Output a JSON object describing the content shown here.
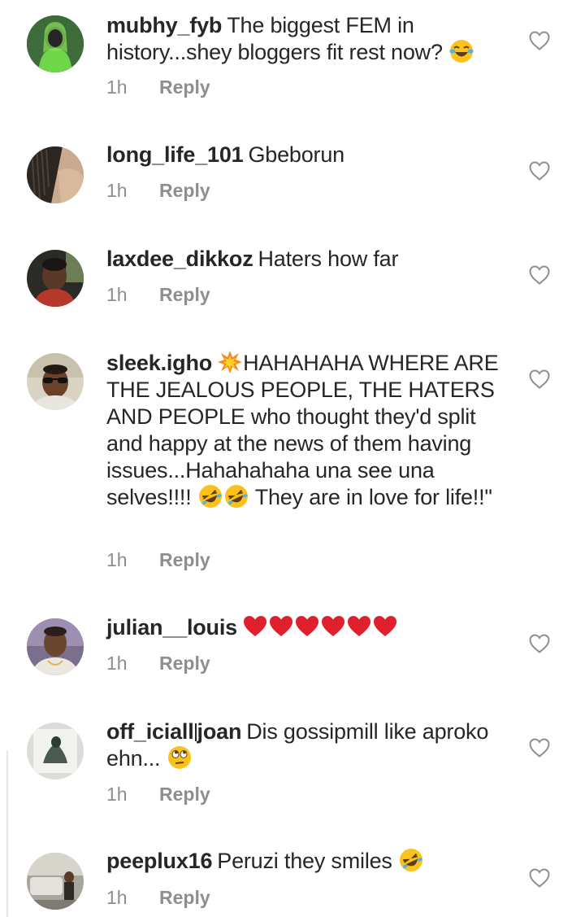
{
  "comments": [
    {
      "username": "mubhy_fyb",
      "text": "The biggest FEM in history...shey bloggers fit rest now?",
      "emojis": [
        "laughing-tears-emoji"
      ],
      "time": "1h",
      "reply": "Reply"
    },
    {
      "username": "long_life_101",
      "text": "Gbeborun",
      "emojis": [],
      "time": "1h",
      "reply": "Reply"
    },
    {
      "username": "laxdee_dikkoz",
      "text": "Haters how far",
      "emojis": [],
      "time": "1h",
      "reply": "Reply"
    },
    {
      "username": "sleek.igho",
      "text_part1": "HAHAHAHA WHERE ARE THE JEALOUS PEOPLE, THE HATERS AND PEOPLE who thought they'd split and happy at the news of them having issues...Hahahahaha una see una selves!!!!",
      "text_part2": "They are in love for life!!\"",
      "emojis": [
        "collision-emoji",
        "rofl-emoji",
        "rofl-emoji"
      ],
      "time": "1h",
      "reply": "Reply"
    },
    {
      "username": "julian__louis",
      "text": "",
      "emojis": [
        "red-heart-emoji",
        "red-heart-emoji",
        "red-heart-emoji",
        "red-heart-emoji",
        "red-heart-emoji",
        "red-heart-emoji"
      ],
      "time": "1h",
      "reply": "Reply"
    },
    {
      "username": "off_iciall\u0004joan",
      "text": "Dis gossipmill like aproko ehn...",
      "emojis": [
        "eye-roll-emoji"
      ],
      "time": "1h",
      "reply": "Reply"
    },
    {
      "username": "peeplux16",
      "text": "Peruzi they smiles",
      "emojis": [
        "rofl-emoji"
      ],
      "time": "1h",
      "reply": "Reply"
    }
  ],
  "colors": {
    "text": "#262626",
    "meta": "#8e8e8e",
    "heart_red": "#e0202c",
    "emoji_yellow": "#fcc21b"
  }
}
